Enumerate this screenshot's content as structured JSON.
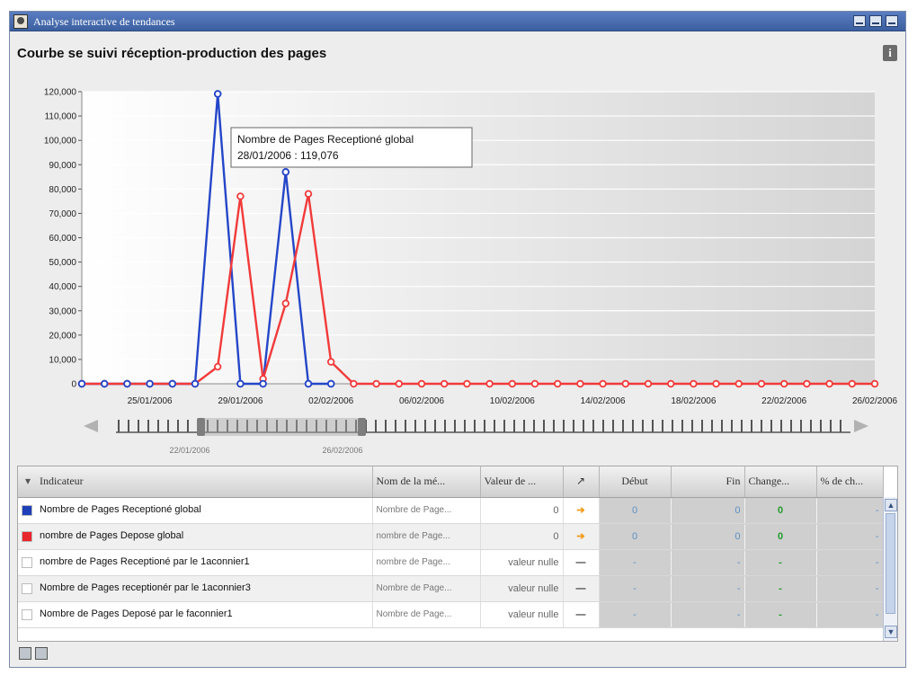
{
  "window": {
    "title": "Analyse interactive de tendances",
    "heading": "Courbe se suivi réception-production des pages",
    "info_glyph": "i"
  },
  "tooltip": {
    "line1": "Nombre de Pages Receptioné global",
    "line2": "28/01/2006 : 119,076"
  },
  "chart_data": {
    "type": "line",
    "x_tick_labels": [
      "25/01/2006",
      "29/01/2006",
      "02/02/2006",
      "06/02/2006",
      "10/02/2006",
      "14/02/2006",
      "18/02/2006",
      "22/02/2006",
      "26/02/2006"
    ],
    "y_tick_labels": [
      "0",
      "10,000",
      "20,000",
      "30,000",
      "40,000",
      "50,000",
      "60,000",
      "70,000",
      "80,000",
      "90,000",
      "100,000",
      "110,000",
      "120,000"
    ],
    "ylim": [
      0,
      120000
    ],
    "x_start": "22/01/2006",
    "x_end": "26/02/2006",
    "grid": true,
    "series": [
      {
        "name": "Nombre de Pages Receptioné global",
        "color": "#2546c8",
        "points": [
          [
            "22/01/2006",
            0
          ],
          [
            "23/01/2006",
            0
          ],
          [
            "24/01/2006",
            0
          ],
          [
            "25/01/2006",
            0
          ],
          [
            "26/01/2006",
            0
          ],
          [
            "27/01/2006",
            0
          ],
          [
            "28/01/2006",
            119076
          ],
          [
            "29/01/2006",
            0
          ],
          [
            "30/01/2006",
            0
          ],
          [
            "31/01/2006",
            87000
          ],
          [
            "01/02/2006",
            0
          ],
          [
            "02/02/2006",
            0
          ]
        ]
      },
      {
        "name": "nombre de Pages Depose global",
        "color": "#f23a3a",
        "points": [
          [
            "22/01/2006",
            0
          ],
          [
            "23/01/2006",
            0
          ],
          [
            "24/01/2006",
            0
          ],
          [
            "25/01/2006",
            0
          ],
          [
            "26/01/2006",
            0
          ],
          [
            "27/01/2006",
            0
          ],
          [
            "28/01/2006",
            7000
          ],
          [
            "29/01/2006",
            77000
          ],
          [
            "30/01/2006",
            2000
          ],
          [
            "31/01/2006",
            33000
          ],
          [
            "01/02/2006",
            78000
          ],
          [
            "02/02/2006",
            9000
          ],
          [
            "03/02/2006",
            0
          ],
          [
            "04/02/2006",
            0
          ],
          [
            "05/02/2006",
            0
          ],
          [
            "06/02/2006",
            0
          ],
          [
            "07/02/2006",
            0
          ],
          [
            "08/02/2006",
            0
          ],
          [
            "09/02/2006",
            0
          ],
          [
            "10/02/2006",
            0
          ],
          [
            "11/02/2006",
            0
          ],
          [
            "12/02/2006",
            0
          ],
          [
            "13/02/2006",
            0
          ],
          [
            "14/02/2006",
            0
          ],
          [
            "15/02/2006",
            0
          ],
          [
            "16/02/2006",
            0
          ],
          [
            "17/02/2006",
            0
          ],
          [
            "18/02/2006",
            0
          ],
          [
            "19/02/2006",
            0
          ],
          [
            "20/02/2006",
            0
          ],
          [
            "21/02/2006",
            0
          ],
          [
            "22/02/2006",
            0
          ],
          [
            "23/02/2006",
            0
          ],
          [
            "24/02/2006",
            0
          ],
          [
            "25/02/2006",
            0
          ],
          [
            "26/02/2006",
            0
          ]
        ]
      }
    ]
  },
  "timeline": {
    "range_start": "22/01/2006",
    "range_end": "26/02/2006"
  },
  "grid": {
    "columns": {
      "indicator": "Indicateur",
      "measure_name": "Nom de la mé...",
      "value": "Valeur de ...",
      "trend": "↗",
      "start": "Début",
      "end": "Fin",
      "change": "Change...",
      "pct_change": "% de ch..."
    },
    "rows": [
      {
        "swatch": "#1d3fb8",
        "indicator": "Nombre de Pages Receptioné global",
        "measure": "Nombre de Page...",
        "value": "0",
        "trend": "➔",
        "start": "0",
        "end": "0",
        "change": "0",
        "pct": "-"
      },
      {
        "swatch": "#e8262b",
        "indicator": "nombre de Pages Depose global",
        "measure": "nombre de Page...",
        "value": "0",
        "trend": "➔",
        "start": "0",
        "end": "0",
        "change": "0",
        "pct": "-"
      },
      {
        "swatch": "#ffffff",
        "indicator": "nombre de Pages Receptioné par le 1aconnier1",
        "measure": "nombre de Page...",
        "value": "valeur nulle",
        "trend": "—",
        "start": "-",
        "end": "-",
        "change": "-",
        "pct": "-"
      },
      {
        "swatch": "#ffffff",
        "indicator": "Nombre de Pages receptionér par le 1aconnier3",
        "measure": "Nombre de Page...",
        "value": "valeur nulle",
        "trend": "—",
        "start": "-",
        "end": "-",
        "change": "-",
        "pct": "-"
      },
      {
        "swatch": "#ffffff",
        "indicator": "Nombre de Pages Deposé par le faconnier1",
        "measure": "Nombre de Page...",
        "value": "valeur nulle",
        "trend": "—",
        "start": "-",
        "end": "-",
        "change": "-",
        "pct": "-"
      }
    ]
  }
}
